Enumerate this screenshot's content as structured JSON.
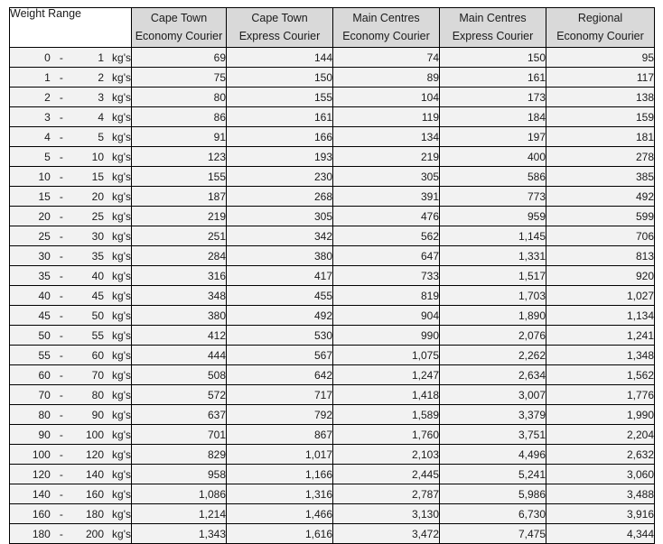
{
  "table": {
    "weight_range_header": "Weight Range",
    "unit_label": "kg's",
    "range_separator": "-",
    "columns": [
      {
        "line1": "Cape Town",
        "line2": "Economy Courier"
      },
      {
        "line1": "Cape Town",
        "line2": "Express Courier"
      },
      {
        "line1": "Main Centres",
        "line2": "Economy Courier"
      },
      {
        "line1": "Main Centres",
        "line2": "Express Courier"
      },
      {
        "line1": "Regional",
        "line2": "Economy Courier"
      }
    ],
    "rows": [
      {
        "from": "0",
        "to": "1",
        "values": [
          "69",
          "144",
          "74",
          "150",
          "95"
        ]
      },
      {
        "from": "1",
        "to": "2",
        "values": [
          "75",
          "150",
          "89",
          "161",
          "117"
        ]
      },
      {
        "from": "2",
        "to": "3",
        "values": [
          "80",
          "155",
          "104",
          "173",
          "138"
        ]
      },
      {
        "from": "3",
        "to": "4",
        "values": [
          "86",
          "161",
          "119",
          "184",
          "159"
        ]
      },
      {
        "from": "4",
        "to": "5",
        "values": [
          "91",
          "166",
          "134",
          "197",
          "181"
        ]
      },
      {
        "from": "5",
        "to": "10",
        "values": [
          "123",
          "193",
          "219",
          "400",
          "278"
        ]
      },
      {
        "from": "10",
        "to": "15",
        "values": [
          "155",
          "230",
          "305",
          "586",
          "385"
        ]
      },
      {
        "from": "15",
        "to": "20",
        "values": [
          "187",
          "268",
          "391",
          "773",
          "492"
        ]
      },
      {
        "from": "20",
        "to": "25",
        "values": [
          "219",
          "305",
          "476",
          "959",
          "599"
        ]
      },
      {
        "from": "25",
        "to": "30",
        "values": [
          "251",
          "342",
          "562",
          "1,145",
          "706"
        ]
      },
      {
        "from": "30",
        "to": "35",
        "values": [
          "284",
          "380",
          "647",
          "1,331",
          "813"
        ]
      },
      {
        "from": "35",
        "to": "40",
        "values": [
          "316",
          "417",
          "733",
          "1,517",
          "920"
        ]
      },
      {
        "from": "40",
        "to": "45",
        "values": [
          "348",
          "455",
          "819",
          "1,703",
          "1,027"
        ]
      },
      {
        "from": "45",
        "to": "50",
        "values": [
          "380",
          "492",
          "904",
          "1,890",
          "1,134"
        ]
      },
      {
        "from": "50",
        "to": "55",
        "values": [
          "412",
          "530",
          "990",
          "2,076",
          "1,241"
        ]
      },
      {
        "from": "55",
        "to": "60",
        "values": [
          "444",
          "567",
          "1,075",
          "2,262",
          "1,348"
        ]
      },
      {
        "from": "60",
        "to": "70",
        "values": [
          "508",
          "642",
          "1,247",
          "2,634",
          "1,562"
        ]
      },
      {
        "from": "70",
        "to": "80",
        "values": [
          "572",
          "717",
          "1,418",
          "3,007",
          "1,776"
        ]
      },
      {
        "from": "80",
        "to": "90",
        "values": [
          "637",
          "792",
          "1,589",
          "3,379",
          "1,990"
        ]
      },
      {
        "from": "90",
        "to": "100",
        "values": [
          "701",
          "867",
          "1,760",
          "3,751",
          "2,204"
        ]
      },
      {
        "from": "100",
        "to": "120",
        "values": [
          "829",
          "1,017",
          "2,103",
          "4,496",
          "2,632"
        ]
      },
      {
        "from": "120",
        "to": "140",
        "values": [
          "958",
          "1,166",
          "2,445",
          "5,241",
          "3,060"
        ]
      },
      {
        "from": "140",
        "to": "160",
        "values": [
          "1,086",
          "1,316",
          "2,787",
          "5,986",
          "3,488"
        ]
      },
      {
        "from": "160",
        "to": "180",
        "values": [
          "1,214",
          "1,466",
          "3,130",
          "6,730",
          "3,916"
        ]
      },
      {
        "from": "180",
        "to": "200",
        "values": [
          "1,343",
          "1,616",
          "3,472",
          "7,475",
          "4,344"
        ]
      }
    ]
  },
  "colors": {
    "header_fill": "#d9d9d9",
    "cell_fill": "#f2f2f2",
    "border": "#000000",
    "page_background": "#ffffff",
    "text": "#1a1a1a"
  }
}
